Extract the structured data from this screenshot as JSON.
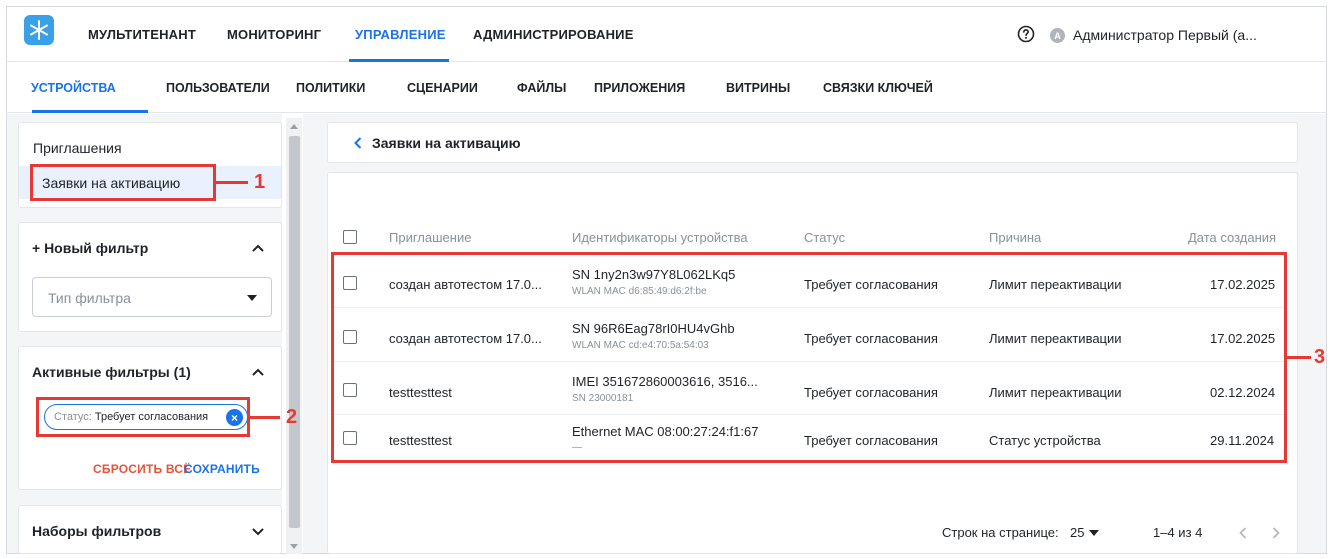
{
  "topnav": {
    "items": [
      "МУЛЬТИТЕНАНТ",
      "МОНИТОРИНГ",
      "УПРАВЛЕНИЕ",
      "АДМИНИСТРИРОВАНИЕ"
    ],
    "active": "УПРАВЛЕНИЕ",
    "user_initial": "A",
    "user_name": "Администратор Первый (а..."
  },
  "subnav": {
    "items": [
      "УСТРОЙСТВА",
      "ПОЛЬЗОВАТЕЛИ",
      "ПОЛИТИКИ",
      "СЦЕНАРИИ",
      "ФАЙЛЫ",
      "ПРИЛОЖЕНИЯ",
      "ВИТРИНЫ",
      "СВЯЗКИ КЛЮЧЕЙ"
    ],
    "active": "УСТРОЙСТВА"
  },
  "sidebar": {
    "menu": [
      "Приглашения",
      "Заявки на активацию"
    ],
    "new_filter": {
      "title": "+ Новый фильтр",
      "select_placeholder": "Тип фильтра"
    },
    "active_filters": {
      "title": "Активные фильтры (1)",
      "chip_key": "Статус:",
      "chip_value": "Требует согласования",
      "reset_label": "СБРОСИТЬ ВСЁ",
      "save_label": "СОХРАНИТЬ"
    },
    "filter_sets": {
      "title": "Наборы фильтров"
    }
  },
  "annotations": [
    "1",
    "2",
    "3"
  ],
  "page": {
    "back_title": "Заявки на активацию"
  },
  "table": {
    "columns": [
      "Приглашение",
      "Идентификаторы устройства",
      "Статус",
      "Причина",
      "Дата создания"
    ],
    "rows": [
      {
        "invite": "создан автотестом 17.0...",
        "id_main": "SN 1ny2n3w97Y8L062LKq5",
        "id_sub": "WLAN MAC d6:85:49:d6:2f:be",
        "status": "Требует согласования",
        "reason": "Лимит переактивации",
        "date": "17.02.2025"
      },
      {
        "invite": "создан автотестом 17.0...",
        "id_main": "SN 96R6Eag78rI0HU4vGhb",
        "id_sub": "WLAN MAC cd:e4:70:5a:54:03",
        "status": "Требует согласования",
        "reason": "Лимит переактивации",
        "date": "17.02.2025"
      },
      {
        "invite": "testtesttest",
        "id_main": "IMEI 351672860003616, 3516...",
        "id_sub": "SN 23000181",
        "status": "Требует согласования",
        "reason": "Лимит переактивации",
        "date": "02.12.2024"
      },
      {
        "invite": "testtesttest",
        "id_main": "Ethernet MAC 08:00:27:24:f1:67",
        "id_sub": "—",
        "status": "Требует согласования",
        "reason": "Статус устройства",
        "date": "29.11.2024"
      }
    ]
  },
  "pagination": {
    "rows_per_page_label": "Строк на странице:",
    "rows_per_page": "25",
    "range": "1–4 из 4"
  },
  "colors": {
    "accent": "#1a73e8",
    "annotation": "#e53935"
  }
}
